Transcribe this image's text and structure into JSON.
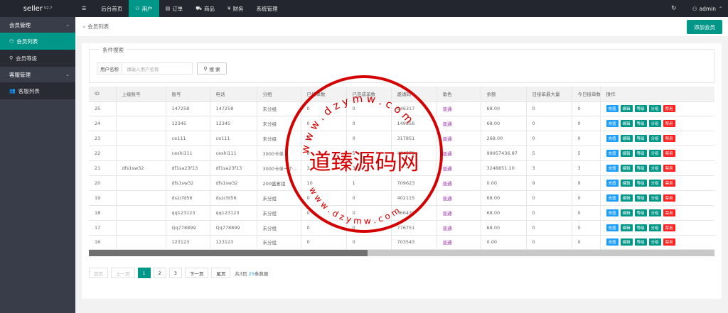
{
  "app": {
    "logo": "seller",
    "version": "V2.7"
  },
  "topnav": [
    {
      "icon": "☰",
      "label": "",
      "active": false
    },
    {
      "icon": "",
      "label": "后台首页",
      "active": false
    },
    {
      "icon": "⚇",
      "label": "用户",
      "active": true
    },
    {
      "icon": "▤",
      "label": "订单",
      "active": false
    },
    {
      "icon": "⛟",
      "label": "商品",
      "active": false
    },
    {
      "icon": "¥",
      "label": "财务",
      "active": false
    },
    {
      "icon": "",
      "label": "系统管理",
      "active": false
    }
  ],
  "topright": {
    "refresh_icon": "↻",
    "user_icon": "⚇",
    "user": "admin",
    "caret": "⌃"
  },
  "sidebar": {
    "group1": "会员管理",
    "items1": [
      {
        "icon": "⚇",
        "label": "会员列表",
        "active": true
      },
      {
        "icon": "⚲",
        "label": "会员等级",
        "active": false
      }
    ],
    "group2": "客服管理",
    "items2": [
      {
        "icon": "👥",
        "label": "客服列表",
        "active": false
      }
    ],
    "caret": "⌄"
  },
  "breadcrumb": {
    "sep": "»",
    "current": "会员列表"
  },
  "add_button": "添加会员",
  "filter": {
    "legend": "条件搜索",
    "label": "用户名称",
    "placeholder": "请输入用户名称",
    "search_icon": "⚲",
    "search_label": "搜 索"
  },
  "table": {
    "columns": [
      "ID",
      "上级账号",
      "账号",
      "电话",
      "分组",
      "已接单数",
      "已完成单数",
      "邀请码",
      "角色",
      "余额",
      "日接单最大量",
      "今日接单数",
      "操作"
    ],
    "ops": [
      "充值",
      "编辑",
      "等级",
      "分组",
      "禁用"
    ],
    "rows": [
      [
        "25",
        "",
        "147258",
        "147258",
        "未分组",
        "0",
        "0",
        "946317",
        "普通",
        "68.00",
        "0",
        "0"
      ],
      [
        "24",
        "",
        "12345",
        "12345",
        "未分组",
        "0",
        "0",
        "149856",
        "普通",
        "68.00",
        "0",
        "0"
      ],
      [
        "23",
        "",
        "ce111",
        "ce111",
        "未分组",
        "0",
        "0",
        "317851",
        "普通",
        "268.00",
        "0",
        "0"
      ],
      [
        "22",
        "",
        "ceshi111",
        "ceshi111",
        "3000卡单...",
        "8",
        "5",
        "464571",
        "普通",
        "99957436.87",
        "5",
        "5"
      ],
      [
        "21",
        "dfs1sw32",
        "df1sa23f13",
        "df1sa23f13",
        "3000卡单一个...",
        "3",
        "3",
        "",
        "普通",
        "3248851.10",
        "3",
        "3"
      ],
      [
        "20",
        "",
        "dfs1sw32",
        "dfs1sw32",
        "200盛宴组",
        "10",
        "1",
        "709623",
        "普通",
        "0.00",
        "9",
        "9"
      ],
      [
        "19",
        "",
        "dszcfd56",
        "dszcfd56",
        "未分组",
        "0",
        "0",
        "402115",
        "普通",
        "68.00",
        "0",
        "0"
      ],
      [
        "18",
        "",
        "qq123123",
        "qq123123",
        "未分组",
        "0",
        "0",
        "566437",
        "普通",
        "68.00",
        "0",
        "0"
      ],
      [
        "17",
        "",
        "Qq778899",
        "Qq778899",
        "未分组",
        "0",
        "0",
        "776751",
        "普通",
        "68.00",
        "0",
        "0"
      ],
      [
        "16",
        "",
        "123123",
        "123123",
        "未分组",
        "0",
        "0",
        "703543",
        "普通",
        "0.00",
        "0",
        "0"
      ]
    ]
  },
  "pager": {
    "first": "首页",
    "prev": "上一页",
    "pages": [
      "1",
      "2",
      "3"
    ],
    "current": "1",
    "next": "下一页",
    "last": "尾页",
    "info_prefix": "共3页",
    "info_count": "25",
    "info_suffix": "条数据"
  },
  "watermark": {
    "text_cn": "道臻源码网",
    "text_top": "w w w . d z y m w . c o m",
    "text_bottom": "w w w . d z y m w . c o m",
    "color": "#d40000"
  },
  "colors": {
    "accent": "#009688",
    "topbar": "#23262e",
    "sidebar": "#393d49",
    "blue": "#1e9fff",
    "red": "#ff2222"
  }
}
